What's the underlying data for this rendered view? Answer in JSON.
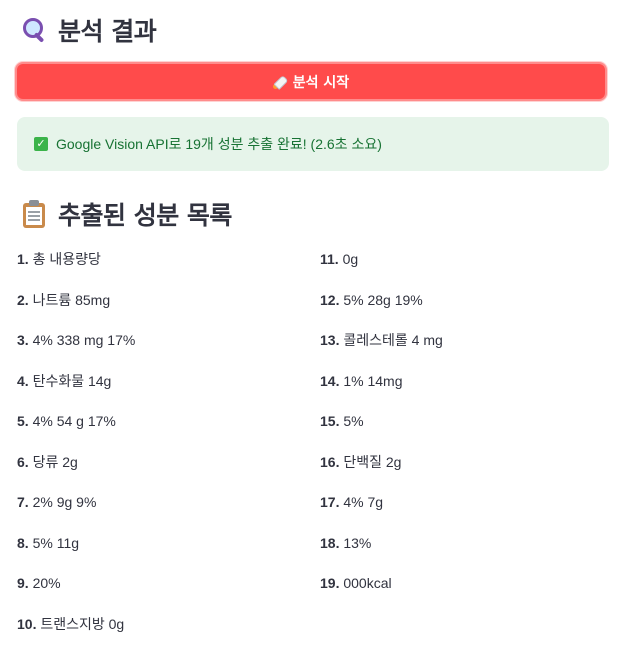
{
  "analysis_header": {
    "icon": "magnifier-icon",
    "title": "분석 결과"
  },
  "start_button": {
    "icon": "rocket-icon",
    "label": "분석 시작"
  },
  "success_alert": {
    "icon": "check-mark-icon",
    "message": "Google Vision API로 19개 성분 추출 완료! (2.6초 소요)"
  },
  "ingredients_header": {
    "icon": "clipboard-icon",
    "title": "추출된 성분 목록"
  },
  "ingredients": [
    {
      "num": "1.",
      "text": "총 내용량당"
    },
    {
      "num": "2.",
      "text": "나트륨 85mg"
    },
    {
      "num": "3.",
      "text": "4% 338 mg 17%"
    },
    {
      "num": "4.",
      "text": "탄수화물 14g"
    },
    {
      "num": "5.",
      "text": "4% 54 g 17%"
    },
    {
      "num": "6.",
      "text": "당류 2g"
    },
    {
      "num": "7.",
      "text": "2% 9g 9%"
    },
    {
      "num": "8.",
      "text": "5% 11g"
    },
    {
      "num": "9.",
      "text": "20%"
    },
    {
      "num": "10.",
      "text": "트랜스지방 0g"
    },
    {
      "num": "11.",
      "text": "0g"
    },
    {
      "num": "12.",
      "text": "5% 28g 19%"
    },
    {
      "num": "13.",
      "text": "콜레스테롤 4 mg"
    },
    {
      "num": "14.",
      "text": "1% 14mg"
    },
    {
      "num": "15.",
      "text": "5%"
    },
    {
      "num": "16.",
      "text": "단백질 2g"
    },
    {
      "num": "17.",
      "text": "4% 7g"
    },
    {
      "num": "18.",
      "text": "13%"
    },
    {
      "num": "19.",
      "text": "000kcal"
    }
  ],
  "colors": {
    "primary_button": "#ff4b4b",
    "success_bg": "#e6f4ea",
    "success_text": "#177233",
    "text": "#31333f"
  }
}
